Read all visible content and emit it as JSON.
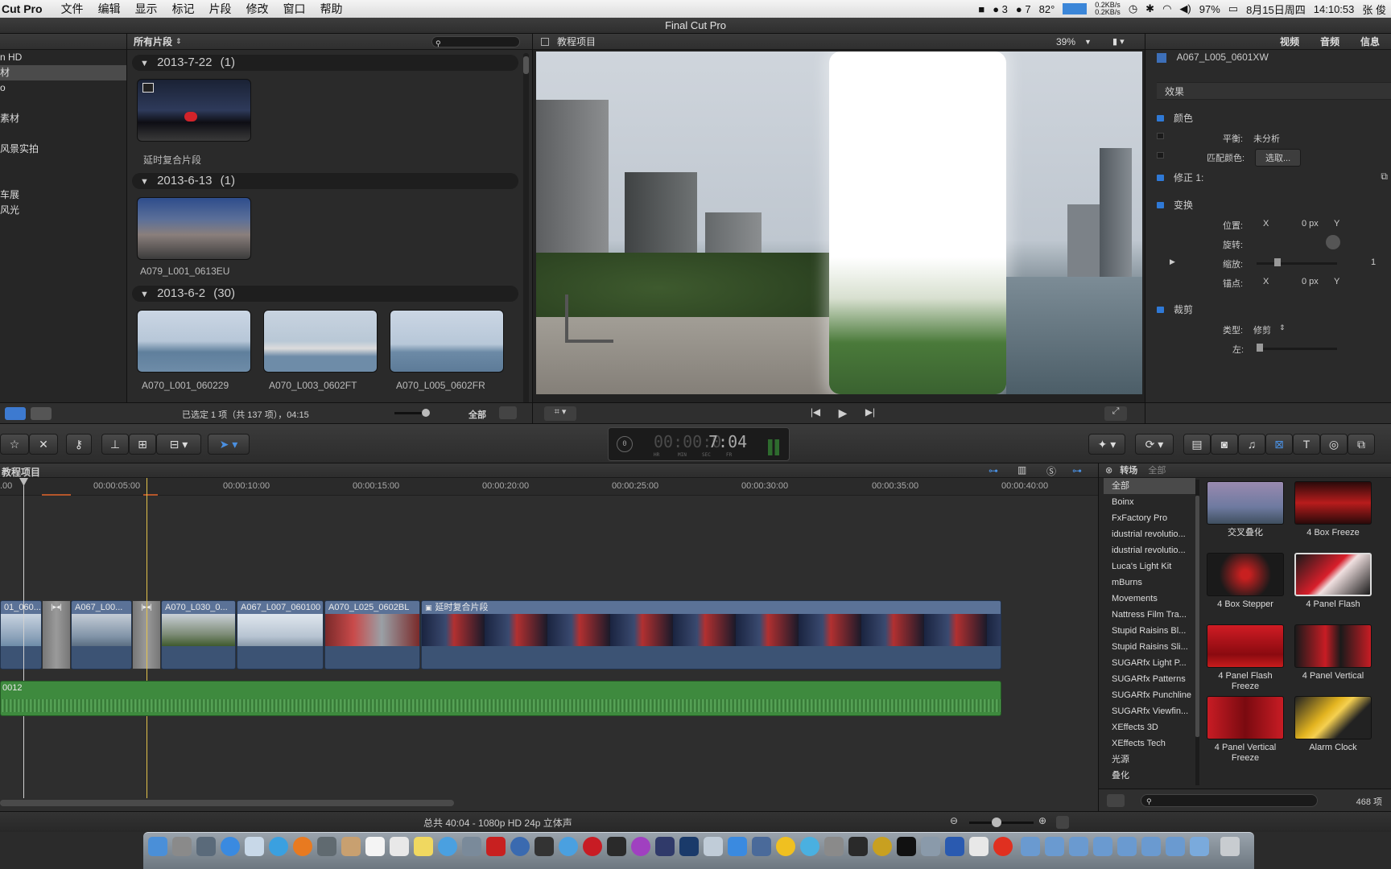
{
  "menubar": {
    "app": "Cut Pro",
    "items": [
      "文件",
      "编辑",
      "显示",
      "标记",
      "片段",
      "修改",
      "窗口",
      "帮助"
    ],
    "status": {
      "qq1": "3",
      "qq2": "7",
      "temp": "82°",
      "net_up": "0.2KB/s",
      "net_down": "0.2KB/s",
      "battery": "97%",
      "date": "8月15日周四",
      "time": "14:10:53",
      "user": "张 俊"
    }
  },
  "window_title": "Final Cut Pro",
  "library": {
    "items": [
      "n HD",
      "材",
      "o",
      "",
      "素材",
      "",
      "风景实拍",
      "",
      "",
      "车展",
      "风光"
    ]
  },
  "browser": {
    "filter_label": "所有片段",
    "search_placeholder": "",
    "groups": [
      {
        "date": "2013-7-22",
        "count": "(1)",
        "clips": [
          "延时复合片段"
        ]
      },
      {
        "date": "2013-6-13",
        "count": "(1)",
        "clips": [
          "A079_L001_0613EU"
        ]
      },
      {
        "date": "2013-6-2",
        "count": "(30)",
        "clips": [
          "A070_L001_060229",
          "A070_L003_0602FT",
          "A070_L005_0602FR"
        ]
      }
    ],
    "footer_selection": "已选定 1 项（共 137 项），04:15",
    "footer_all": "全部"
  },
  "viewer": {
    "title": "教程项目",
    "zoom": "39%"
  },
  "inspector": {
    "tabs": [
      "视频",
      "音频",
      "信息"
    ],
    "clip_name": "A067_L005_0601XW",
    "effects_label": "效果",
    "color_section": "颜色",
    "balance_label": "平衡:",
    "balance_value": "未分析",
    "match_label": "匹配颜色:",
    "match_button": "选取...",
    "correction": "修正 1:",
    "transform_section": "变换",
    "position_label": "位置:",
    "position_x": "X",
    "position_val": "0 px",
    "position_y": "Y",
    "rotation_label": "旋转:",
    "scale_label": "缩放:",
    "scale_value": "1",
    "anchor_label": "锚点:",
    "anchor_x": "X",
    "anchor_val": "0 px",
    "anchor_y": "Y",
    "crop_section": "裁剪",
    "type_label": "类型:",
    "type_value": "修剪",
    "left_label": "左:"
  },
  "timecode": {
    "value": "00:00:07:04",
    "dim_part": "00:00:0",
    "lit_part": "7:04",
    "units": [
      "HR",
      "MIN",
      "SEC",
      "FR"
    ],
    "indicator": "0"
  },
  "timeline": {
    "title": "教程项目",
    "ruler": [
      ".00",
      "00:00:05:00",
      "00:00:10:00",
      "00:00:15:00",
      "00:00:20:00",
      "00:00:25:00",
      "00:00:30:00",
      "00:00:35:00",
      "00:00:40:00"
    ],
    "clips": [
      "01_060...",
      "A067_L00...",
      "A070_L030_0...",
      "A067_L007_060100",
      "A070_L025_0602BL",
      "延时复合片段"
    ],
    "audio_label": "0012"
  },
  "fx_browser": {
    "title": "转场",
    "scope": "全部",
    "categories": [
      "全部",
      "Boinx",
      "FxFactory Pro",
      "idustrial revolutio...",
      "idustrial revolutio...",
      "Luca's Light Kit",
      "mBurns",
      "Movements",
      "Nattress Film Tra...",
      "Stupid Raisins Bl...",
      "Stupid Raisins Sli...",
      "SUGARfx Light P...",
      "SUGARfx Patterns",
      "SUGARfx Punchline",
      "SUGARfx Viewfin...",
      "XEffects 3D",
      "XEffects Tech",
      "光源",
      "叠化"
    ],
    "items": [
      "交叉叠化",
      "4 Box Freeze",
      "4 Box Stepper",
      "4 Panel Flash",
      "4 Panel Flash Freeze",
      "4 Panel Vertical",
      "4 Panel Vertical Freeze",
      "Alarm Clock"
    ],
    "count": "468 项"
  },
  "status_bar": {
    "summary": "总共 40:04 - 1080p HD 24p 立体声"
  }
}
